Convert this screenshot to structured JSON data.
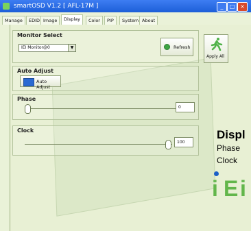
{
  "window": {
    "title": "smartOSD V1.2 [ AFL-17M ]"
  },
  "titlebar_buttons": {
    "minimize": "_",
    "maximize": "□",
    "close": "×"
  },
  "tabs": [
    {
      "label": "Manage"
    },
    {
      "label": "EDID"
    },
    {
      "label": "Image"
    },
    {
      "label": "Display"
    },
    {
      "label": "Color"
    },
    {
      "label": "PIP"
    },
    {
      "label": "System"
    },
    {
      "label": "About"
    }
  ],
  "monitor_select": {
    "title": "Monitor Select",
    "selected": "IEI Monitor@0",
    "refresh_label": "Refresh",
    "apply_label": "Apply All"
  },
  "auto_adjust": {
    "title": "Auto Adjust",
    "button_label": "Auto Adjust"
  },
  "phase": {
    "title": "Phase",
    "value": "0"
  },
  "clock": {
    "title": "Clock",
    "value": "100"
  },
  "overlay": {
    "heading": "Displ",
    "line1": "Phase",
    "line2": "Clock"
  },
  "logo": {
    "text": "iEi",
    "letters": [
      "i",
      "E",
      "i"
    ]
  },
  "colors": {
    "accent": "#1d5fd8",
    "green": "#4fb248",
    "logo_green": "#62b64b",
    "logo_blue": "#1b5fc7"
  }
}
